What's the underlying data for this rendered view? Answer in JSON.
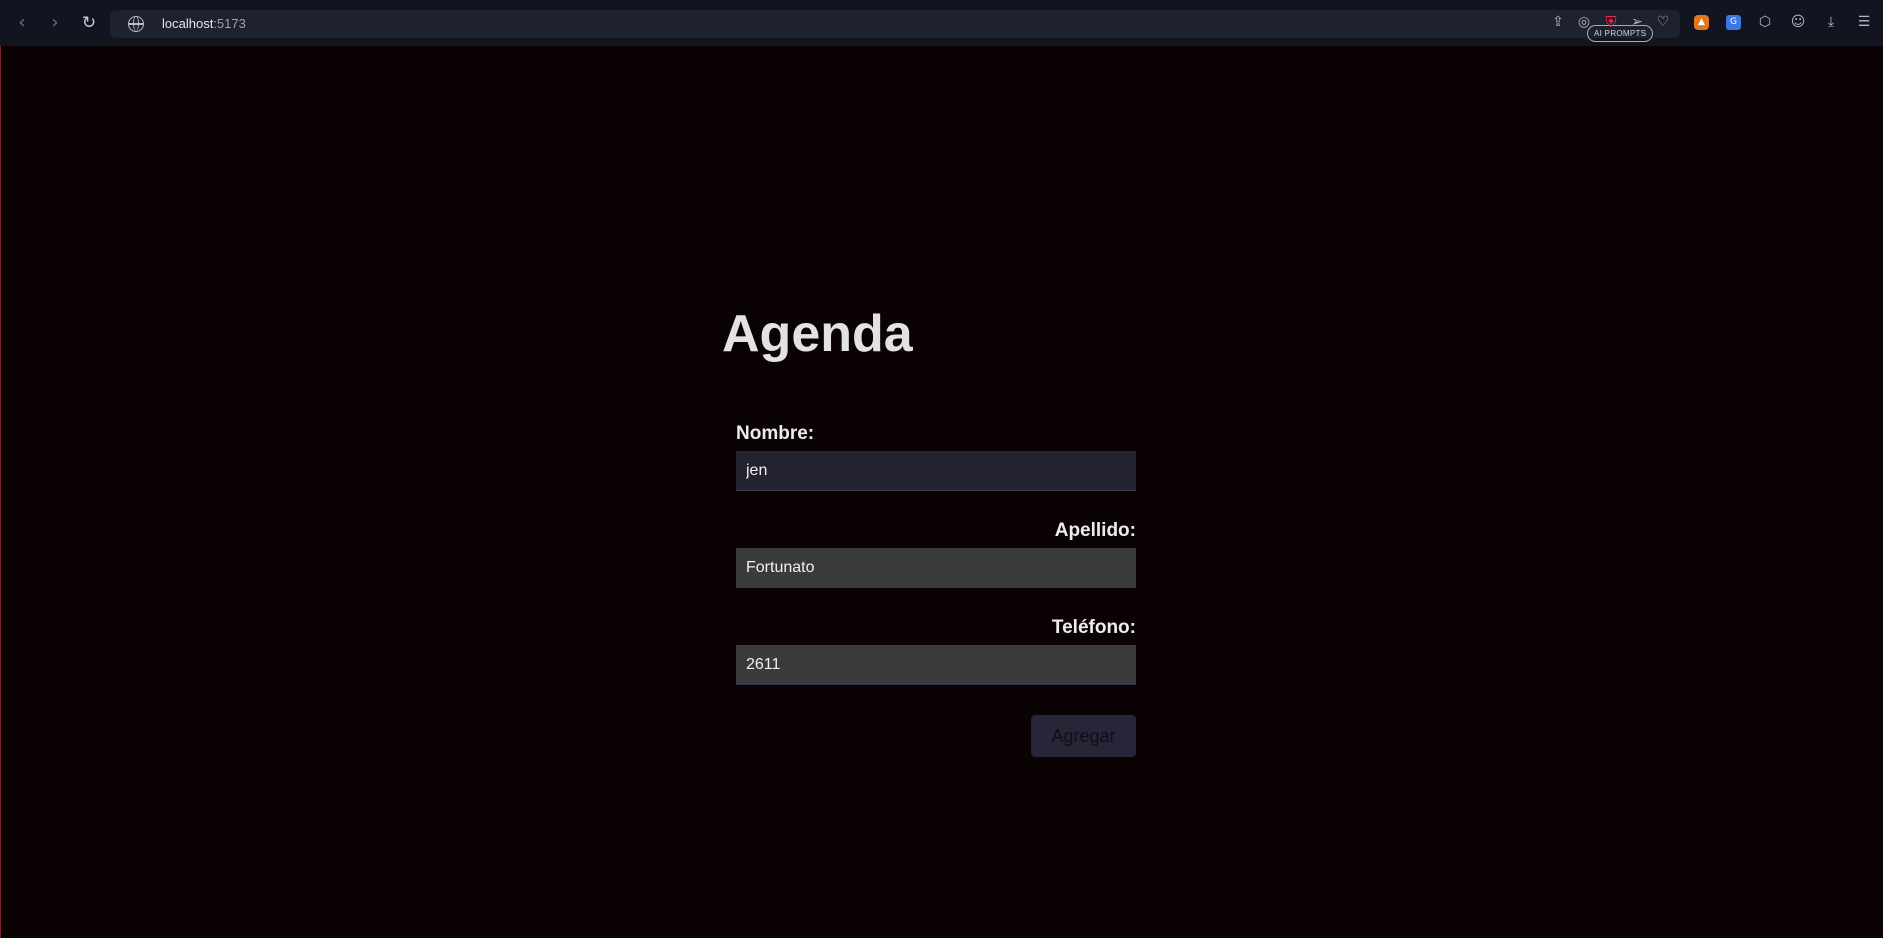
{
  "browser": {
    "url_host": "localhost",
    "url_port": ":5173",
    "ai_prompts_label": "AI PROMPTS"
  },
  "page": {
    "title": "Agenda"
  },
  "form": {
    "nombre": {
      "label": "Nombre:",
      "value": "jen"
    },
    "apellido": {
      "label": "Apellido:",
      "value": "Fortunato"
    },
    "telefono": {
      "label": "Teléfono:",
      "value": "2611"
    },
    "submit_label": "Agregar"
  },
  "colors": {
    "background": "#0b0203",
    "accent": "#c2304a",
    "input_active": "#23232f",
    "input_filled": "#3b3b3b",
    "button": "#262638"
  }
}
